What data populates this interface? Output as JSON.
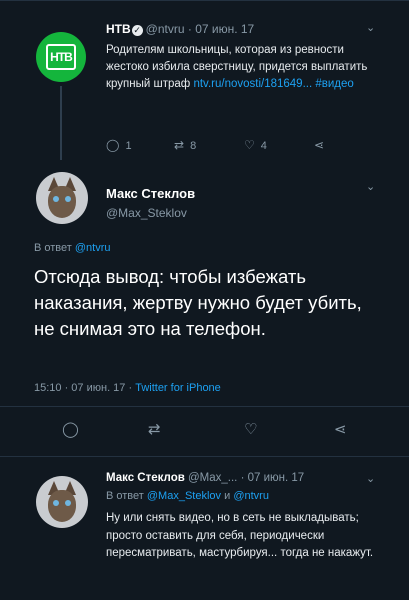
{
  "tweet1": {
    "author_name": "НТВ",
    "handle": "@ntvru",
    "date": "· 07 июн. 17",
    "avatar_text": "НТВ",
    "body": "Родителям школьницы, которая из ревности жестоко избила сверстницу, придется выплатить крупный штраф",
    "link": "ntv.ru/novosti/181649...",
    "hashtag": "#видео",
    "replies": "1",
    "retweets": "8",
    "likes": "4"
  },
  "tweet2": {
    "author_name": "Макс Стеклов",
    "handle": "@Max_Steklov",
    "reply_prefix": "В ответ",
    "reply_to": "@ntvru",
    "text": "Отсюда вывод: чтобы избежать наказания, жертву нужно будет убить, не снимая это на телефон.",
    "time": "15:10 · 07 июн. 17 ·",
    "client": "Twitter for iPhone"
  },
  "tweet3": {
    "author_name": "Макс Стеклов",
    "handle": "@Max_...",
    "date": "· 07 июн. 17",
    "reply_prefix": "В ответ",
    "reply_to_1": "@Max_Steklov",
    "reply_and": "и",
    "reply_to_2": "@ntvru",
    "body": "Ну или снять видео, но в сеть не выкладывать; просто оставить для себя, периодически пересматривать, мастурбируя... тогда не накажут."
  },
  "colors": {
    "background": "#101820",
    "link": "#1da1f2",
    "muted": "#8899a6",
    "ntv_green": "#14b53c"
  },
  "icons": {
    "reply": "reply-icon",
    "retweet": "retweet-icon",
    "like": "heart-icon",
    "share": "share-icon",
    "more": "chevron-down-icon"
  }
}
